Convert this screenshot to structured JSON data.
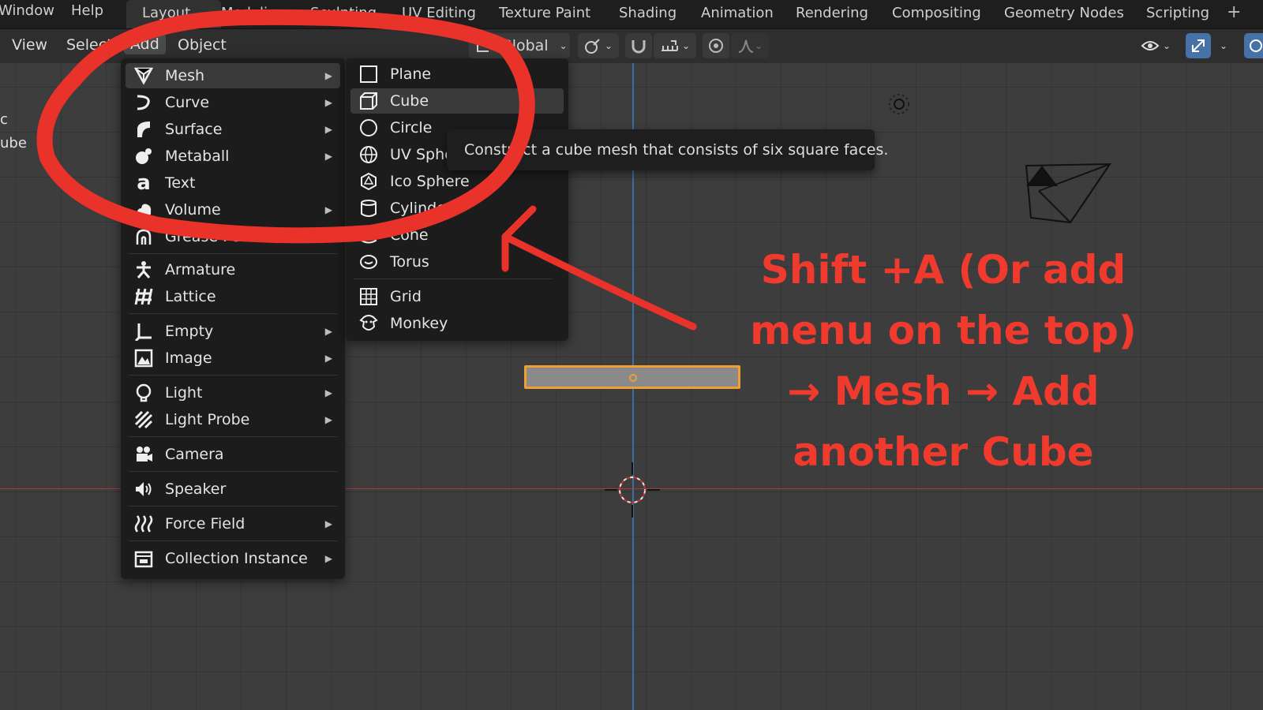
{
  "topbar": {
    "menus": [
      "Window",
      "Help"
    ],
    "tabs": [
      "Layout",
      "Modeling",
      "Sculpting",
      "UV Editing",
      "Texture Paint",
      "Shading",
      "Animation",
      "Rendering",
      "Compositing",
      "Geometry Nodes",
      "Scripting"
    ],
    "active_tab": "Layout",
    "plus": "+"
  },
  "header": {
    "view": "View",
    "select": "Select",
    "add": "Add",
    "object": "Object",
    "transform_orientation": "Global"
  },
  "add_menu": {
    "items": [
      {
        "label": "Mesh",
        "icon": "mesh-icon",
        "submenu": true
      },
      {
        "label": "Curve",
        "icon": "curve-icon",
        "submenu": true
      },
      {
        "label": "Surface",
        "icon": "surface-icon",
        "submenu": true
      },
      {
        "label": "Metaball",
        "icon": "metaball-icon",
        "submenu": true
      },
      {
        "label": "Text",
        "icon": "text-icon",
        "submenu": false
      },
      {
        "label": "Volume",
        "icon": "volume-icon",
        "submenu": true
      },
      {
        "label": "Grease Pencil",
        "icon": "grease-pencil-icon",
        "submenu": true
      },
      {
        "label": "Armature",
        "icon": "armature-icon",
        "submenu": false
      },
      {
        "label": "Lattice",
        "icon": "lattice-icon",
        "submenu": false
      },
      {
        "label": "Empty",
        "icon": "empty-icon",
        "submenu": true
      },
      {
        "label": "Image",
        "icon": "image-icon",
        "submenu": true
      },
      {
        "label": "Light",
        "icon": "light-icon",
        "submenu": true
      },
      {
        "label": "Light Probe",
        "icon": "light-probe-icon",
        "submenu": true
      },
      {
        "label": "Camera",
        "icon": "camera-icon",
        "submenu": false
      },
      {
        "label": "Speaker",
        "icon": "speaker-icon",
        "submenu": false
      },
      {
        "label": "Force Field",
        "icon": "force-field-icon",
        "submenu": true
      },
      {
        "label": "Collection Instance",
        "icon": "collection-instance-icon",
        "submenu": true
      }
    ]
  },
  "mesh_menu": {
    "items": [
      {
        "label": "Plane",
        "icon": "plane-icon"
      },
      {
        "label": "Cube",
        "icon": "cube-icon"
      },
      {
        "label": "Circle",
        "icon": "circle-icon"
      },
      {
        "label": "UV Sphere",
        "icon": "uv-sphere-icon"
      },
      {
        "label": "Ico Sphere",
        "icon": "ico-sphere-icon"
      },
      {
        "label": "Cylinder",
        "icon": "cylinder-icon"
      },
      {
        "label": "Cone",
        "icon": "cone-icon"
      },
      {
        "label": "Torus",
        "icon": "torus-icon"
      },
      {
        "label": "Grid",
        "icon": "grid-icon"
      },
      {
        "label": "Monkey",
        "icon": "monkey-icon"
      }
    ],
    "highlighted": "Cube"
  },
  "tooltip": "Construct a cube mesh that consists of six square faces.",
  "annotation": {
    "lines": [
      "Shift +A (Or add",
      "menu on the top)",
      "→ Mesh → Add",
      "another Cube"
    ],
    "color": "#f03a2e"
  },
  "left_labels": [
    "c",
    "ube"
  ],
  "colors": {
    "accent_highlight": "#4672a8",
    "selection_outline": "#f0a030",
    "annotation_red": "#e8322a"
  }
}
